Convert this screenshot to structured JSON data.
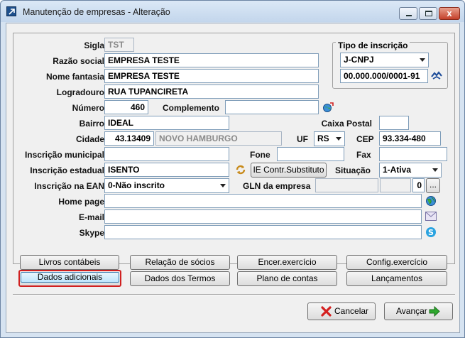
{
  "window": {
    "title": "Manutenção de empresas - Alteração",
    "min_label": "",
    "close_label": "x"
  },
  "form": {
    "sigla_label": "Sigla",
    "sigla_value": "TST",
    "razao_label": "Razão social",
    "razao_value": "EMPRESA TESTE",
    "fantasia_label": "Nome fantasia",
    "fantasia_value": "EMPRESA TESTE",
    "logradouro_label": "Logradouro",
    "logradouro_value": "RUA TUPANCIRETA",
    "numero_label": "Número",
    "numero_value": "460",
    "complemento_label": "Complemento",
    "complemento_value": "",
    "bairro_label": "Bairro",
    "bairro_value": "IDEAL",
    "caixa_postal_label": "Caixa Postal",
    "caixa_postal_value": "",
    "cidade_label": "Cidade",
    "cidade_code": "43.13409",
    "cidade_name": "NOVO HAMBURGO",
    "uf_label": "UF",
    "uf_value": "RS",
    "cep_label": "CEP",
    "cep_value": "93.334-480",
    "insc_municipal_label": "Inscrição municipal",
    "insc_municipal_value": "",
    "fone_label": "Fone",
    "fone_value": "",
    "fax_label": "Fax",
    "fax_value": "",
    "insc_estadual_label": "Inscrição estadual",
    "insc_estadual_value": "ISENTO",
    "ie_substituto_label": "IE Contr.Substituto",
    "situacao_label": "Situação",
    "situacao_value": "1-Ativa",
    "ean_label": "Inscrição na EAN",
    "ean_value": "0-Não inscrito",
    "gln_label": "GLN da empresa",
    "gln_value": "",
    "gln_mid": "",
    "gln_count": "0",
    "gln_btn": "...",
    "homepage_label": "Home page",
    "homepage_value": "",
    "email_label": "E-mail",
    "email_value": "",
    "skype_label": "Skype",
    "skype_value": ""
  },
  "tipo_inscricao": {
    "title": "Tipo de inscrição",
    "type_value": "J-CNPJ",
    "number_value": "00.000.000/0001-91"
  },
  "buttons": {
    "livros": "Livros contábeis",
    "socios": "Relação de sócios",
    "encer": "Encer.exercício",
    "config": "Config.exercício",
    "dados_adicionais": "Dados adicionais",
    "termos": "Dados dos Termos",
    "plano": "Plano de contas",
    "lancamentos": "Lançamentos",
    "cancelar": "Cancelar",
    "avancar": "Avançar"
  }
}
